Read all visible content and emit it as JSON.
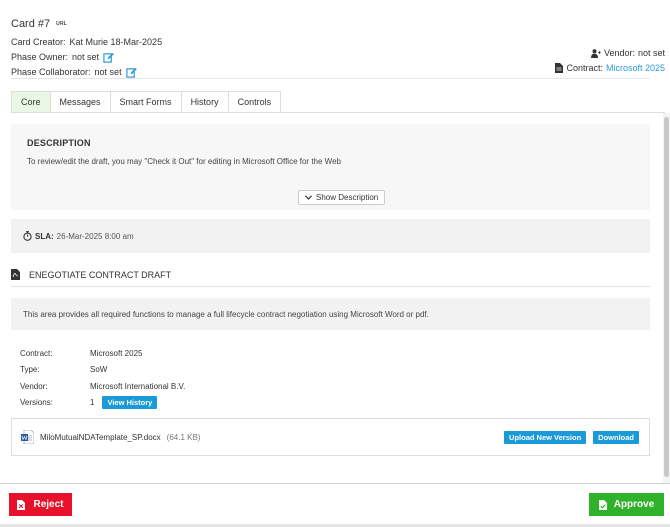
{
  "header": {
    "card_title": "Card #7",
    "url_label": "URL",
    "creator_label": "Card Creator:",
    "creator_value": "Kat Murie 18-Mar-2025",
    "owner_label": "Phase Owner:",
    "owner_value": "not set",
    "collaborator_label": "Phase Collaborator:",
    "collaborator_value": "not set",
    "vendor_label": "Vendor:",
    "vendor_value": "not set",
    "contract_label": "Contract:",
    "contract_value": "Microsoft 2025"
  },
  "tabs": [
    {
      "label": "Core",
      "active": true
    },
    {
      "label": "Messages",
      "active": false
    },
    {
      "label": "Smart Forms",
      "active": false
    },
    {
      "label": "History",
      "active": false
    },
    {
      "label": "Controls",
      "active": false
    }
  ],
  "description": {
    "title": "DESCRIPTION",
    "text": "To review/edit the draft, you may \"Check it Out\" for editing in Microsoft Office for the Web",
    "show_button": "Show Description"
  },
  "sla": {
    "label": "SLA:",
    "value": "26-Mar-2025 8:00 am"
  },
  "section": {
    "title": "ENEGOTIATE CONTRACT DRAFT",
    "info_text": "This area provides all required functions to manage a full lifecycle contract negotiation using Microsoft Word or pdf."
  },
  "fields": {
    "contract_label": "Contract:",
    "contract_value": "Microsoft 2025",
    "type_label": "Type:",
    "type_value": "SoW",
    "vendor_label": "Vendor:",
    "vendor_value": "Microsoft International B.V.",
    "versions_label": "Versions:",
    "versions_value": "1",
    "view_history_button": "View History"
  },
  "file": {
    "name": "MiloMutualNDATemplate_SP.docx",
    "size": "(64.1 KB)",
    "upload_button": "Upload New Version",
    "download_button": "Download"
  },
  "footer": {
    "reject_label": "Reject",
    "approve_label": "Approve"
  },
  "colors": {
    "accent": "#1a9ad6",
    "reject": "#e8102a",
    "approve": "#2fb12b",
    "active_tab": "#eaf7e4"
  },
  "icons": [
    "edit-icon",
    "vendor-user-icon",
    "contract-document-icon",
    "stopwatch-icon",
    "pdf-file-icon",
    "chevron-down-icon",
    "word-doc-icon",
    "reject-document-icon",
    "approve-document-icon"
  ]
}
